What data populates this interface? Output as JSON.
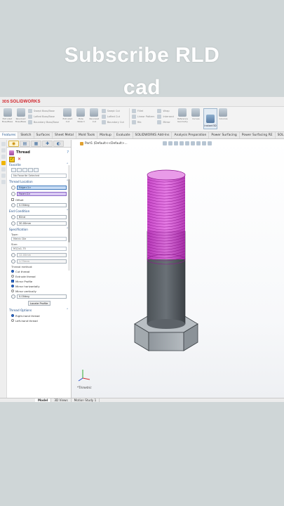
{
  "overlay": {
    "line1": "Subscribe RLD",
    "line2": "cad"
  },
  "app": {
    "brand_prefix": "3DS",
    "brand": "SOLIDWORKS"
  },
  "ribbon": {
    "tools": [
      "Extruded Boss/Base",
      "Revolved Boss/Base"
    ],
    "groups": [
      [
        "Swept Boss/Base",
        "Lofted Boss/Base",
        "Boundary Boss/Base"
      ],
      [
        "Swept Cut",
        "Lofted Cut",
        "Boundary Cut"
      ],
      [
        "Fillet",
        "Linear Pattern",
        "Rib",
        "Draft",
        "Shell"
      ],
      [
        "Wrap",
        "Intersect",
        "Mirror"
      ]
    ],
    "tools_right": [
      "Extruded Cut",
      "Hole Wizard",
      "Revolved Cut"
    ],
    "tools_far": [
      "Reference Geometry",
      "Curves"
    ],
    "instant": "Instant3D",
    "extra": "Colorize"
  },
  "command_tabs": [
    "Features",
    "Sketch",
    "Surfaces",
    "Sheet Metal",
    "Mold Tools",
    "Markup",
    "Evaluate",
    "SOLIDWORKS Add-Ins",
    "Analysis Preparation",
    "Power Surfacing",
    "Power Surfacing RE",
    "SOLIDWORKS"
  ],
  "property_manager": {
    "title": "Thread",
    "help": "?",
    "ok": "✓",
    "cancel": "✕",
    "favorite_label": "Favorite",
    "favorite_value": "No Favorite Selected",
    "thread_location_label": "Thread Location",
    "edge_value": "Edge<1>",
    "face_value": "Face<1>",
    "offset_label": "Offset",
    "offset_value": "0.00deg",
    "end_condition_label": "End Condition",
    "end_condition_value": "Blind",
    "depth_value": "30.00mm",
    "specification_label": "Specification",
    "type_label": "Type:",
    "type_value": "Metric Die",
    "size_label": "Size:",
    "size_value": "M12x1.75",
    "diameter_value": "12.00mm",
    "pitch_value": "1.75mm",
    "thread_method_label": "Thread method:",
    "cut_thread": "Cut thread",
    "extrude_thread": "Extrude thread",
    "mirror_profile_label": "Mirror Profile",
    "mirror_h": "Mirror horizontally",
    "mirror_v": "Mirror vertically",
    "rotation_value": "0.00deg",
    "locate_profile": "Locate Profile",
    "thread_options_label": "Thread Options",
    "right_hand": "Right-hand thread",
    "left_hand": "Left-hand thread"
  },
  "graphics": {
    "breadcrumb": "Part1 (Default<<Default>...",
    "view_label": "*Trimetric"
  },
  "bottom_tabs": [
    "Model",
    "3D Views",
    "Motion Study 1"
  ],
  "colors": {
    "thread": "#d94fd8",
    "bolt_dark": "#5a6066",
    "bolt_mid": "#8a9198",
    "accent": "#2f6fd6"
  }
}
